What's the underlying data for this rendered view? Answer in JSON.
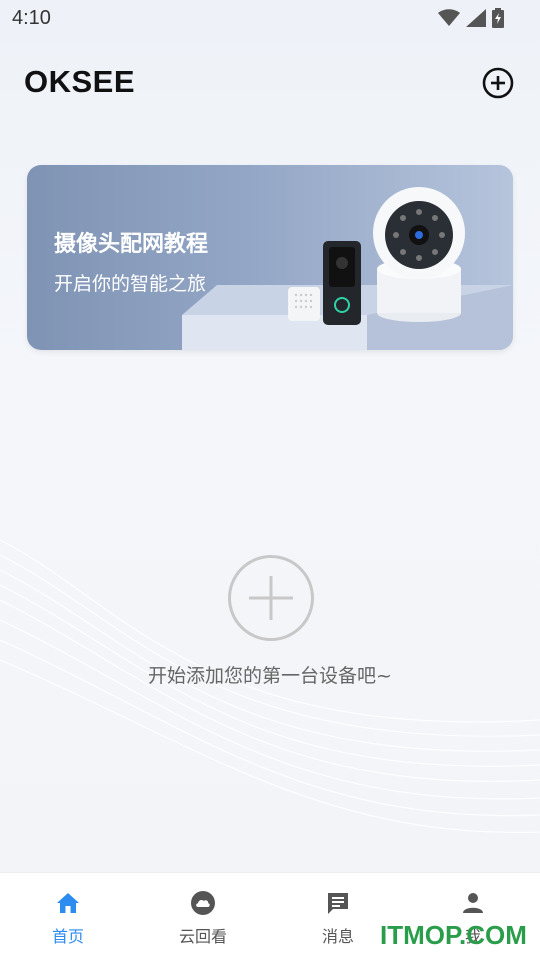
{
  "status_bar": {
    "time": "4:10"
  },
  "header": {
    "title": "OKSEE"
  },
  "banner": {
    "title": "摄像头配网教程",
    "subtitle": "开启你的智能之旅"
  },
  "empty_state": {
    "message": "开始添加您的第一台设备吧~"
  },
  "tab_bar": {
    "tabs": [
      {
        "label": "首页",
        "icon": "home-icon",
        "active": true
      },
      {
        "label": "云回看",
        "icon": "cloud-icon",
        "active": false
      },
      {
        "label": "消息",
        "icon": "message-icon",
        "active": false
      },
      {
        "label": "我",
        "icon": "person-icon",
        "active": false
      }
    ]
  },
  "watermark": {
    "text": "ITMOP.COM"
  },
  "colors": {
    "accent": "#2d8cf0",
    "watermark": "#2a9d4b"
  }
}
